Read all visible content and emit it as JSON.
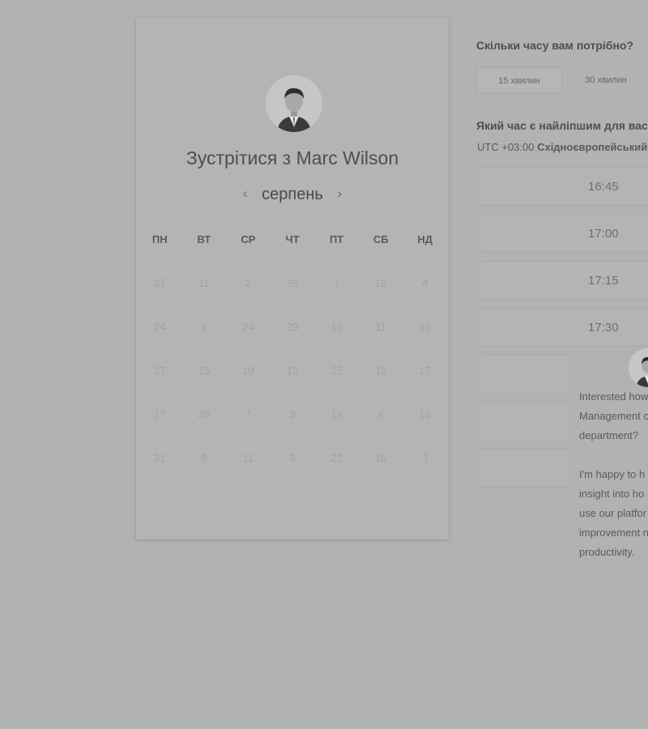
{
  "booking": {
    "title_prefix": "Зустрітися з",
    "host_name": "Marc Wilson",
    "month": "серпень",
    "prev_icon": "‹",
    "next_icon": "›",
    "weekdays": [
      "ПН",
      "ВТ",
      "СР",
      "ЧТ",
      "ПТ",
      "СБ",
      "НД"
    ],
    "weeks": [
      [
        "27",
        "11",
        "2",
        "26",
        "7",
        "18",
        "4"
      ],
      [
        "24",
        "1",
        "24",
        "29",
        "10",
        "11",
        "26"
      ],
      [
        "27",
        "15",
        "10",
        "13",
        "25",
        "12",
        "17"
      ],
      [
        "17",
        "28",
        "7",
        "3",
        "14",
        "4",
        "16"
      ],
      [
        "31",
        "8",
        "11",
        "3",
        "22",
        "16",
        "3"
      ]
    ]
  },
  "scheduler": {
    "duration_question": "Скільки часу вам потрібно?",
    "durations": [
      "15 хвилин",
      "30 хвилин"
    ],
    "time_question": "Який час є найліпшим для вас?",
    "timezone_offset": "UTC +03:00",
    "timezone_name": "Східноєвропейський час",
    "slots": [
      "16:45",
      "17:00",
      "17:15",
      "17:30",
      "",
      "",
      ""
    ]
  },
  "chat": {
    "lines_1": [
      "Interested how",
      "Management c",
      "department?"
    ],
    "lines_2": [
      "I'm happy to h",
      "insight into ho",
      "use our platfor",
      "improvement n",
      "productivity."
    ]
  },
  "icons": {
    "avatar": "host-avatar-photo",
    "chat_avatar": "chat-avatar-photo"
  }
}
